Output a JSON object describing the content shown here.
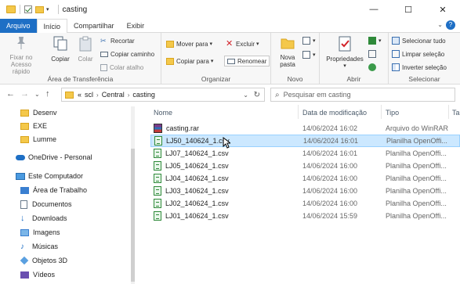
{
  "window": {
    "title": "casting",
    "controls": {
      "minimize": "—",
      "maximize": "☐",
      "close": "✕"
    }
  },
  "ribbon_tabs": [
    "Arquivo",
    "Início",
    "Compartilhar",
    "Exibir"
  ],
  "ribbon": {
    "clipboard": {
      "pin": "Fixar no\nAcesso rápido",
      "copy": "Copiar",
      "paste": "Colar",
      "cut": "Recortar",
      "copy_path": "Copiar caminho",
      "paste_shortcut": "Colar atalho",
      "label": "Área de Transferência"
    },
    "organize": {
      "move_to": "Mover para",
      "copy_to": "Copiar para",
      "delete": "Excluir",
      "rename": "Renomear",
      "label": "Organizar"
    },
    "new": {
      "new_folder": "Nova\npasta",
      "label": "Novo"
    },
    "open": {
      "properties": "Propriedades",
      "label": "Abrir"
    },
    "select": {
      "select_all": "Selecionar tudo",
      "clear_selection": "Limpar seleção",
      "invert_selection": "Inverter seleção",
      "label": "Selecionar"
    }
  },
  "address": {
    "prefix": "«",
    "segments": [
      "scl",
      "Central",
      "casting"
    ],
    "search_placeholder": "Pesquisar em casting"
  },
  "nav": {
    "items": [
      {
        "label": "Desenv",
        "icon": "folder-icon"
      },
      {
        "label": "EXE",
        "icon": "folder-icon"
      },
      {
        "label": "Lumme",
        "icon": "folder-icon"
      },
      {
        "label": "OneDrive - Personal",
        "icon": "cloud-icon"
      },
      {
        "label": "Este Computador",
        "icon": "computer-icon"
      },
      {
        "label": "Área de Trabalho",
        "icon": "desktop-icon"
      },
      {
        "label": "Documentos",
        "icon": "documents-icon"
      },
      {
        "label": "Downloads",
        "icon": "download-icon"
      },
      {
        "label": "Imagens",
        "icon": "images-icon"
      },
      {
        "label": "Músicas",
        "icon": "music-icon"
      },
      {
        "label": "Objetos 3D",
        "icon": "cube-icon"
      },
      {
        "label": "Vídeos",
        "icon": "video-icon"
      }
    ]
  },
  "columns": [
    "Nome",
    "Data de modificação",
    "Tipo",
    "Ta"
  ],
  "files": [
    {
      "name": "casting.rar",
      "date": "14/06/2024 16:02",
      "type": "Arquivo do WinRAR",
      "icon": "rar-icon"
    },
    {
      "name": "LJ50_140624_1.csv",
      "date": "14/06/2024 16:01",
      "type": "Planilha OpenOffi...",
      "icon": "csv-icon",
      "selected": true
    },
    {
      "name": "LJ07_140624_1.csv",
      "date": "14/06/2024 16:01",
      "type": "Planilha OpenOffi...",
      "icon": "csv-icon"
    },
    {
      "name": "LJ05_140624_1.csv",
      "date": "14/06/2024 16:00",
      "type": "Planilha OpenOffi...",
      "icon": "csv-icon"
    },
    {
      "name": "LJ04_140624_1.csv",
      "date": "14/06/2024 16:00",
      "type": "Planilha OpenOffi...",
      "icon": "csv-icon"
    },
    {
      "name": "LJ03_140624_1.csv",
      "date": "14/06/2024 16:00",
      "type": "Planilha OpenOffi...",
      "icon": "csv-icon"
    },
    {
      "name": "LJ02_140624_1.csv",
      "date": "14/06/2024 16:00",
      "type": "Planilha OpenOffi...",
      "icon": "csv-icon"
    },
    {
      "name": "LJ01_140624_1.csv",
      "date": "14/06/2024 15:59",
      "type": "Planilha OpenOffi...",
      "icon": "csv-icon"
    }
  ],
  "colors": {
    "accent": "#1e6fc5",
    "selection": "#cce8ff",
    "selection_border": "#99d1ff"
  }
}
